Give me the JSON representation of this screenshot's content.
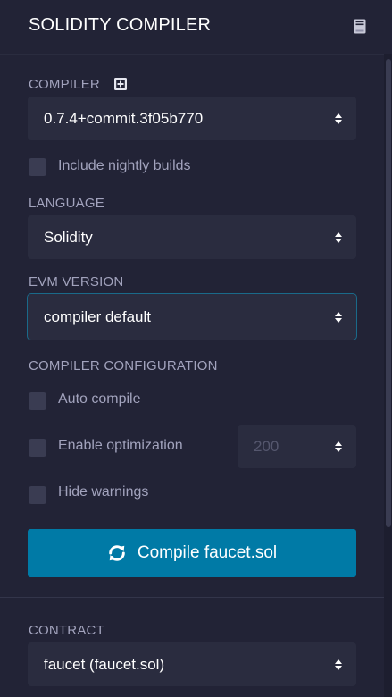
{
  "header": {
    "title": "SOLIDITY COMPILER",
    "doc_icon": "book-icon"
  },
  "compiler": {
    "label": "COMPILER",
    "add_icon": "plus-square-icon",
    "selected": "0.7.4+commit.3f05b770",
    "nightly_label": "Include nightly builds",
    "nightly_checked": false
  },
  "language": {
    "label": "LANGUAGE",
    "selected": "Solidity"
  },
  "evm": {
    "label": "EVM VERSION",
    "selected": "compiler default"
  },
  "config": {
    "label": "COMPILER CONFIGURATION",
    "auto_compile_label": "Auto compile",
    "auto_compile_checked": false,
    "optimization_label": "Enable optimization",
    "optimization_checked": false,
    "runs_value": "200",
    "hide_warnings_label": "Hide warnings",
    "hide_warnings_checked": false
  },
  "compile_button": {
    "label": "Compile faucet.sol",
    "icon": "refresh-icon"
  },
  "contract": {
    "label": "CONTRACT",
    "selected": "faucet (faucet.sol)"
  },
  "colors": {
    "background": "#222336",
    "accent": "#007aa6",
    "input_bg": "#2a2c3f"
  }
}
